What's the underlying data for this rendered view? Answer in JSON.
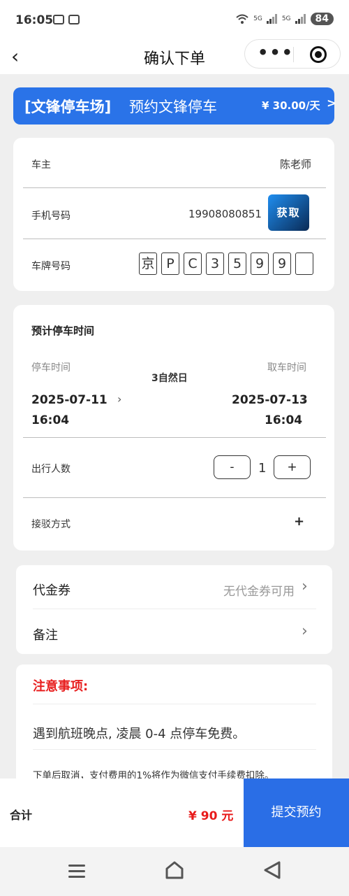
{
  "status_bar": {
    "time": "16:05",
    "signal_1": "5G",
    "signal_2": "5G",
    "battery": "84"
  },
  "nav": {
    "title": "确认下单",
    "more_icon": "more-dots-icon",
    "close_icon": "target-circle-icon"
  },
  "banner": {
    "title": "[文锋停车场]",
    "subtitle": "预约文锋停车",
    "price": "¥ 30.00/天",
    "arrow": ">",
    "color": "#2a73e8"
  },
  "owner_card": {
    "owner_label": "车主",
    "owner_value": "陈老师",
    "phone_label": "手机号码",
    "phone_value": "19908080851",
    "get_button": "获取",
    "plate_label": "车牌号码",
    "plate_chars": [
      "京",
      "P",
      "C",
      "3",
      "5",
      "9",
      "9",
      ""
    ]
  },
  "time_card": {
    "title": "预计停车时间",
    "park_label": "停车时间",
    "pickup_label": "取车时间",
    "duration": "3自然日",
    "park_date": "2025-07-11",
    "park_time": "16:04",
    "pickup_date": "2025-07-13",
    "pickup_time": "16:04",
    "chevron": "›",
    "travelers_label": "出行人数",
    "minus": "-",
    "count": "1",
    "plus": "+",
    "transfer_label": "接驳方式",
    "transfer_plus": "+"
  },
  "options_card": {
    "coupon_label": "代金券",
    "coupon_value": "无代金券可用",
    "note_label": "备注",
    "chevron": "›"
  },
  "notice": {
    "title": "注意事项:",
    "line1": "遇到航班晚点, 凌晨 0-4 点停车免费。",
    "line2": "下单后取消，支付费用的1%将作为微信支付手续费扣除。",
    "title_color": "#e82020"
  },
  "bottom_bar": {
    "total_label": "合计",
    "total_price": "¥ 90 元",
    "submit": "提交预约",
    "price_color": "#e81a1a",
    "submit_color": "#2a6ee6"
  },
  "system_nav": {
    "menu_icon": "menu-icon",
    "home_icon": "home-icon",
    "back_icon": "back-triangle-icon"
  }
}
